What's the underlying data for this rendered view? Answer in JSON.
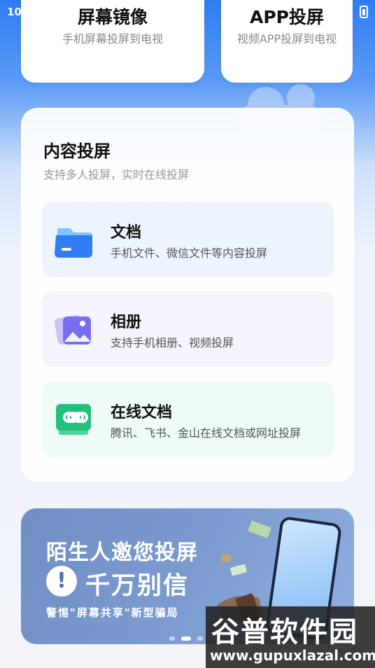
{
  "status_bar": {
    "time": "10"
  },
  "top_cards": [
    {
      "title": "屏幕镜像",
      "subtitle": "手机屏幕投屏到电视"
    },
    {
      "title": "APP投屏",
      "subtitle": "视频APP投屏到电视"
    }
  ],
  "content_section": {
    "title": "内容投屏",
    "subtitle": "支持多人投屏，实时在线投屏",
    "items": [
      {
        "name": "文档",
        "desc": "手机文件、微信文件等内容投屏",
        "icon": "folder-icon"
      },
      {
        "name": "相册",
        "desc": "支持手机相册、视频投屏",
        "icon": "photo-album-icon"
      },
      {
        "name": "在线文档",
        "desc": "腾讯、飞书、金山在线文档或网址投屏",
        "icon": "link-icon"
      }
    ]
  },
  "banner": {
    "line1": "陌生人邀您投屏",
    "warn_symbol": "!",
    "line2": "千万别信",
    "line3": "警惕\"屏幕共享\"新型骗局",
    "page_count": 3,
    "active_page": 2
  },
  "watermark": {
    "title": "谷普软件园",
    "url": "www.gupuxlazal.com"
  }
}
